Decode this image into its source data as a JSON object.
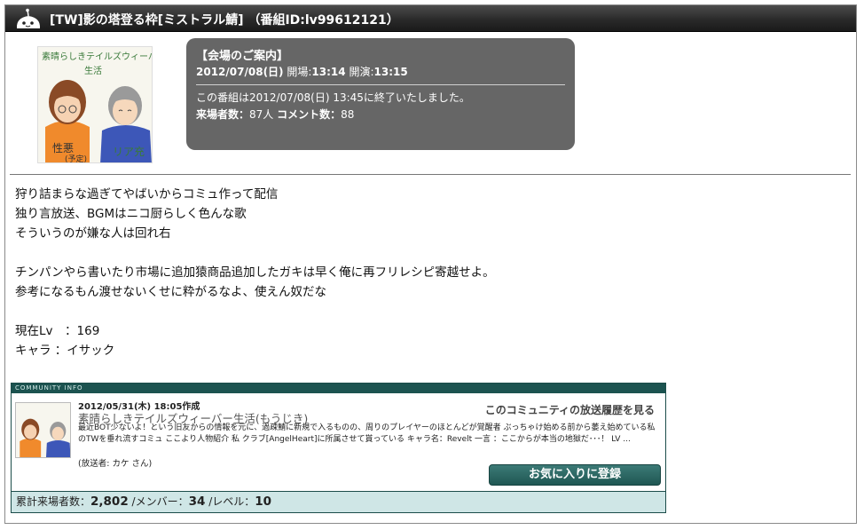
{
  "header": {
    "title": "[TW]影の塔登る枠[ミストラル鯖] （番組ID:lv99612121）",
    "icon": "tv-mascot-icon"
  },
  "thumbnail": {
    "title_line1": "素晴らしきテイルズウィーバー",
    "title_line2": "生活",
    "badge_left": "性悪",
    "badge_sub": "(予定)",
    "badge_right": "リア充"
  },
  "venue": {
    "heading": "【会場のご案内】",
    "date": "2012/07/08(日)",
    "open_label": "開場:",
    "open_time": "13:14",
    "start_label": "開演:",
    "start_time": "13:15",
    "ended_text": "この番組は2012/07/08(日) 13:45に終了いたしました。",
    "visitors_label": "来場者数：",
    "visitors_value": "87人",
    "comments_label": "コメント数：",
    "comments_value": "88"
  },
  "description": {
    "line1": "狩り詰まらな過ぎてやばいからコミュ作って配信",
    "line2": "独り言放送、BGMはニコ厨らしく色んな歌",
    "line3": "そういうのが嫌な人は回れ右",
    "line4": "チンパンやら書いたり市場に追加猿商品追加したガキは早く俺に再フリレシピ寄越せよ。",
    "line5": "参考になるもん渡せないくせに粋がるなよ、使えん奴だな",
    "line6": "現在Lv　：169",
    "line7": "キャラ ：イサック"
  },
  "community": {
    "bar_label": "COMMUNITY INFO",
    "created": "2012/05/31(木) 18:05作成",
    "name": "素晴らしきテイルズウィーバー生活(もうじき)",
    "history_link": "このコミュニティの放送履歴を見る",
    "text": "最近BOT少ないよ！という旧友からの情報を元に、過疎鯖に新規で入るものの、周りのプレイヤーのほとんどが覚醒者 ぶっちゃけ始める前から萎え始めている私のTWを垂れ流すコミュ ここより人物紹介 私 クラブ[AngelHeart]に所属させて貰っている キャラ名：Revelt 一言 ：ここからが本当の地獄だ･･･！ LV ...",
    "caster_prefix": "(放送者: ",
    "caster_name": "カケ",
    "caster_suffix": " さん)",
    "fav_button": "お気に入りに登録",
    "stats_visitors_label": "累計来場者数：",
    "stats_visitors": "2,802",
    "stats_members_label": " /メンバー：",
    "stats_members": "34",
    "stats_level_label": " /レベル：",
    "stats_level": "10"
  },
  "colors": {
    "titlebar": "#2a2a2a",
    "infobox": "#666666",
    "community_accent": "#1c5350",
    "stats_bg": "#cfe6e6"
  }
}
